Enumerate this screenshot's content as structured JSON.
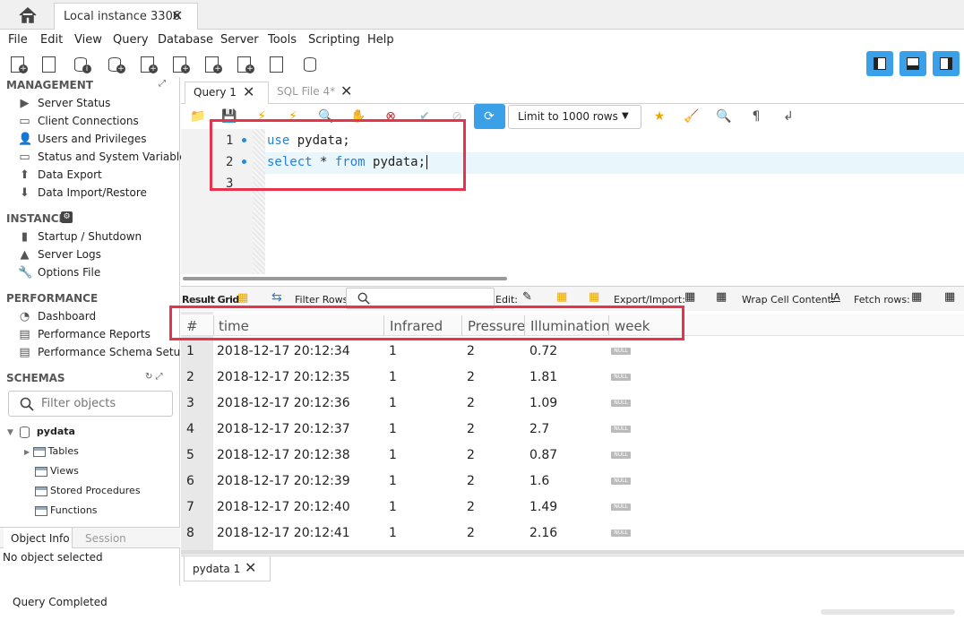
{
  "connection_tab": {
    "title": "Local instance 3306"
  },
  "menu": [
    "File",
    "Edit",
    "View",
    "Query",
    "Database",
    "Server",
    "Tools",
    "Scripting",
    "Help"
  ],
  "sidebar": {
    "management": {
      "title": "MANAGEMENT",
      "items": [
        "Server Status",
        "Client Connections",
        "Users and Privileges",
        "Status and System Variables",
        "Data Export",
        "Data Import/Restore"
      ]
    },
    "instance": {
      "title": "INSTANCE",
      "items": [
        "Startup / Shutdown",
        "Server Logs",
        "Options File"
      ]
    },
    "performance": {
      "title": "PERFORMANCE",
      "items": [
        "Dashboard",
        "Performance Reports",
        "Performance Schema Setup"
      ]
    },
    "schemas": {
      "title": "SCHEMAS",
      "filter_placeholder": "Filter objects",
      "db": "pydata",
      "children": [
        "Tables",
        "Views",
        "Stored Procedures",
        "Functions"
      ]
    },
    "info_tabs": [
      "Object Info",
      "Session"
    ],
    "info_text": "No object selected"
  },
  "query_tabs": [
    "Query 1",
    "SQL File 4*"
  ],
  "limit_select": "Limit to 1000 rows",
  "editor": {
    "lines": [
      {
        "num": "1",
        "kw": "use",
        "rest": " pydata;"
      },
      {
        "num": "2",
        "kw": "select",
        "mid": " * ",
        "kw2": "from",
        "rest": " pydata;"
      },
      {
        "num": "3"
      }
    ]
  },
  "result_toolbar": {
    "result_grid": "Result Grid",
    "filter_rows": "Filter Rows:",
    "edit": "Edit:",
    "export_import": "Export/Import:",
    "wrap": "Wrap Cell Content:",
    "fetch": "Fetch rows:"
  },
  "grid": {
    "columns": [
      "#",
      "time",
      "Infrared",
      "Pressure",
      "Illumination",
      "week"
    ],
    "rows": [
      [
        "1",
        "2018-12-17 20:12:34",
        "1",
        "2",
        "0.72",
        "NULL"
      ],
      [
        "2",
        "2018-12-17 20:12:35",
        "1",
        "2",
        "1.81",
        "NULL"
      ],
      [
        "3",
        "2018-12-17 20:12:36",
        "1",
        "2",
        "1.09",
        "NULL"
      ],
      [
        "4",
        "2018-12-17 20:12:37",
        "1",
        "2",
        "2.7",
        "NULL"
      ],
      [
        "5",
        "2018-12-17 20:12:38",
        "1",
        "2",
        "0.87",
        "NULL"
      ],
      [
        "6",
        "2018-12-17 20:12:39",
        "1",
        "2",
        "1.6",
        "NULL"
      ],
      [
        "7",
        "2018-12-17 20:12:40",
        "1",
        "2",
        "1.49",
        "NULL"
      ],
      [
        "8",
        "2018-12-17 20:12:41",
        "1",
        "2",
        "2.16",
        "NULL"
      ]
    ]
  },
  "result_tab": "pydata 1",
  "status": "Query Completed",
  "colors": {
    "accent": "#3aa0e8",
    "highlight_box": "#e8334e",
    "keyword": "#2a7fd0"
  }
}
